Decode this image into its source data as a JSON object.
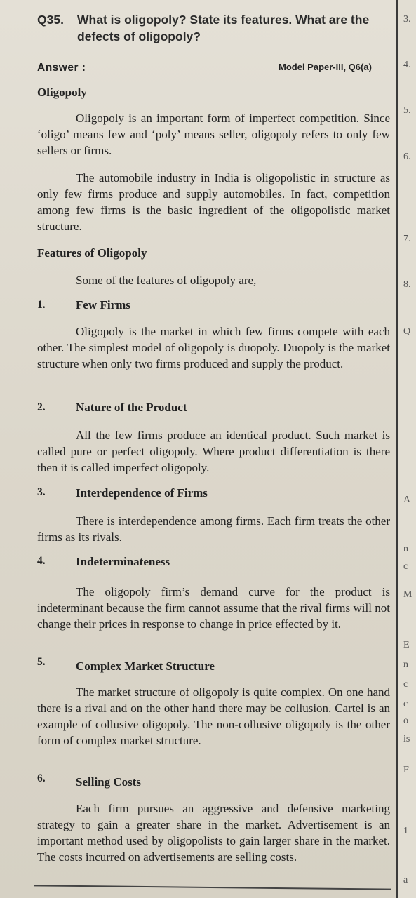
{
  "question": {
    "number": "Q35.",
    "text": "What is oligopoly? State its features. What are the defects of oligopoly?"
  },
  "answer_label": "Answer :",
  "model_ref": "Model Paper-III, Q6(a)",
  "heading_oligopoly": "Oligopoly",
  "para1": "Oligopoly is an important form of imperfect competition. Since ‘oligo’ means few and ‘poly’ means seller, oligopoly refers to only few sellers or firms.",
  "para2": "The automobile industry in India is oligopolistic in structure as only few firms produce and supply automobiles. In fact, competition among few firms is the basic ingredient of the oligopolistic market structure.",
  "heading_features": "Features of Oligopoly",
  "intro_features": "Some of the features of oligopoly are,",
  "features": [
    {
      "num": "1.",
      "title": "Few Firms",
      "text": "Oligopoly is the market in which few firms compete with each other. The simplest model of oligopoly is duopoly. Duopoly is the market structure when only two firms produced and supply the product."
    },
    {
      "num": "2.",
      "title": "Nature of the Product",
      "text": "All the few firms produce an identical product. Such market is called pure or perfect oligopoly. Where product differentiation is there then it is called imperfect oligopoly."
    },
    {
      "num": "3.",
      "title": "Interdependence of Firms",
      "text": "There is interdependence among firms. Each firm treats the other firms as its rivals."
    },
    {
      "num": "4.",
      "title": "Indeterminateness",
      "text": "The oligopoly firm’s demand curve for the product is indeterminant because the firm cannot assume that the rival firms will not change their prices in response to change in price effected by it."
    },
    {
      "num": "5.",
      "title": "Complex Market Structure",
      "text": "The market structure of oligopoly is quite complex. On one hand there is a rival and on the other hand there may be collusion. Cartel is an example of collusive oligopoly. The non-collusive oligopoly is the other form of complex market structure."
    },
    {
      "num": "6.",
      "title": "Selling Costs",
      "text": "Each firm pursues an aggressive and defensive marketing strategy to gain a greater share in the market. Advertisement is an important method used by oligopolists to gain larger share in the market. The costs incurred on advertisements are selling costs."
    }
  ],
  "right_column": [
    "3.",
    "4.",
    "5.",
    "6.",
    "7.",
    "8.",
    "Q",
    "A",
    "n",
    "c",
    "M",
    "E",
    "n",
    "c",
    "c",
    "o",
    "is",
    "F",
    "1",
    "a"
  ]
}
